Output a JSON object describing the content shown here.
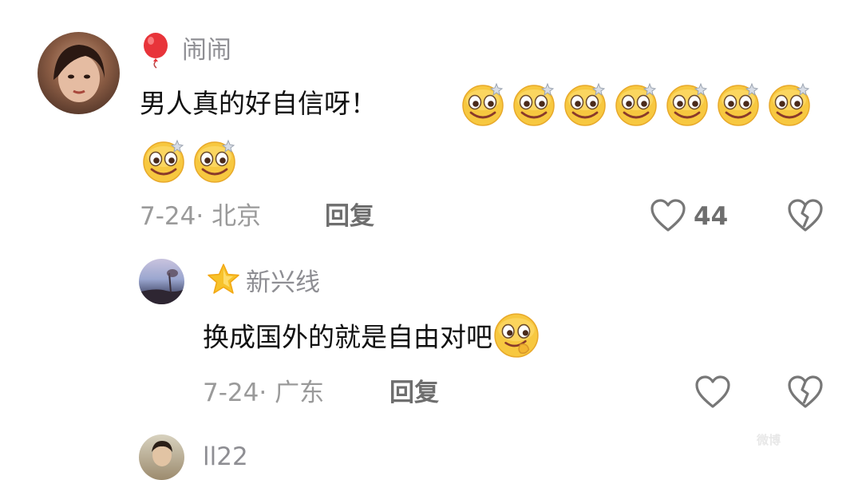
{
  "comments": [
    {
      "author": "闹闹",
      "badge_icon": "balloon-icon",
      "text": "男人真的好自信呀！",
      "emoji": "dizzy-smile-emoji",
      "emoji_count": 9,
      "date_location": "7-24· 北京",
      "reply_label": "回复",
      "like_count": "44"
    },
    {
      "author": "新兴线",
      "badge_icon": "star-icon",
      "text": "换成国外的就是自由对吧",
      "emoji": "smirk-emoji",
      "date_location": "7-24· 广东",
      "reply_label": "回复",
      "like_count": ""
    },
    {
      "author": "ll22"
    }
  ],
  "watermark": "微博",
  "colors": {
    "secondary_text": "#9a9a9a",
    "author_text": "#8e8e93",
    "emoji_yellow": "#f5c43a"
  }
}
